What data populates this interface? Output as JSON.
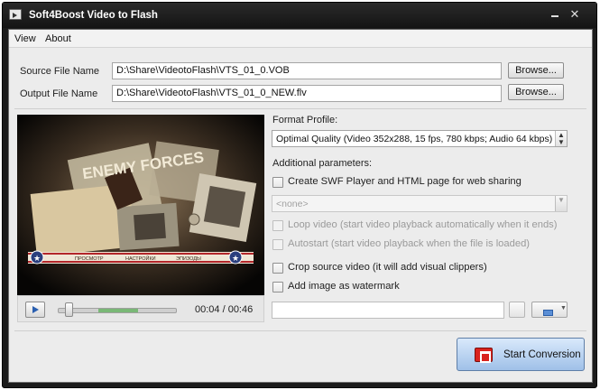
{
  "window": {
    "title": "Soft4Boost Video to Flash",
    "close_glyph": "✕"
  },
  "menu": {
    "items": [
      {
        "label": "View"
      },
      {
        "label": "About"
      }
    ]
  },
  "files": {
    "source_label": "Source File Name",
    "source_value": "D:\\Share\\VideotoFlash\\VTS_01_0.VOB",
    "output_label": "Output File Name",
    "output_value": "D:\\Share\\VideotoFlash\\VTS_01_0_NEW.flv",
    "browse_label": "Browse..."
  },
  "preview": {
    "poster_text": "ENEMY FORCES",
    "menu_labels": [
      "ПРОСМОТР",
      "НАСТРОЙКИ",
      "ЭПИЗОДЫ"
    ],
    "time": "00:04 / 00:46",
    "seek": {
      "position": 0.09,
      "range_start": 0.34,
      "range_end": 0.68
    }
  },
  "settings": {
    "format_profile_label": "Format Profile:",
    "format_profile_value": "Optimal Quality (Video 352x288, 15 fps, 780 kbps; Audio 64 kbps)",
    "additional_label": "Additional parameters:",
    "swf_checkbox_label": "Create SWF Player and HTML page for web sharing",
    "player_skin_value": "<none>",
    "loop_label": "Loop video (start video playback automatically when it ends)",
    "autostart_label": "Autostart (start video playback when the file is loaded)",
    "crop_label": "Crop source video (it will add visual clippers)",
    "watermark_label": "Add image as watermark"
  },
  "actions": {
    "start_label": "Start Conversion"
  },
  "colors": {
    "titlebar": "#1b1b1b",
    "start_button": "#aac8ee",
    "seek_range": "#7ab877"
  }
}
